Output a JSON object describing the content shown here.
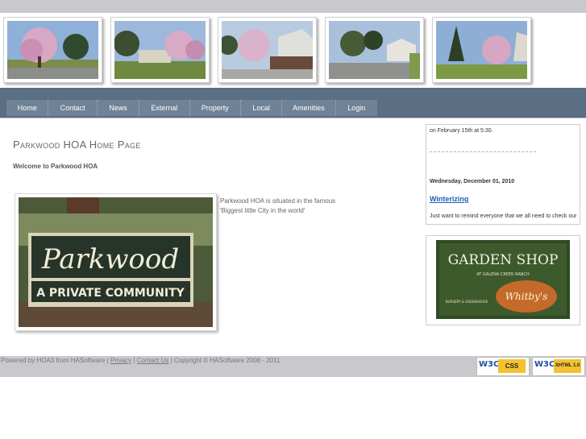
{
  "banner": {
    "photos": [
      "pink-blossom-tree-photo",
      "street-trees-photo",
      "house-blossom-photo",
      "driveway-house-photo",
      "evergreen-blossom-photo"
    ]
  },
  "nav": {
    "items": [
      {
        "label": "Home"
      },
      {
        "label": "Contact"
      },
      {
        "label": "News"
      },
      {
        "label": "External"
      },
      {
        "label": "Property"
      },
      {
        "label": "Local"
      },
      {
        "label": "Amenities"
      },
      {
        "label": "Login"
      }
    ]
  },
  "main": {
    "title": "Parkwood HOA Home Page",
    "welcome": "Welcome to Parkwood HOA",
    "sign_text_line1": "Parkwood",
    "sign_text_line2": "A PRIVATE COMMUNITY",
    "description": "Parkwood HOA is situated in the famous 'Biggest little City in the world'"
  },
  "sidebar": {
    "news_text_1": "on February 15th at 5:30.",
    "news_date": "Wednesday, December 01, 2010",
    "news_link": "Winterizing",
    "news_text_2": "Just want to remind everyone that we all need to check our",
    "ad_title": "GARDEN SHOP",
    "ad_subtitle": "AT GALENA CREEK RANCH",
    "ad_brand": "Whitby's",
    "ad_tagline": "NURSERY & GREENHOUSE"
  },
  "footer": {
    "powered": "Powered by HOA3 from HASoftware |",
    "privacy": "Privacy",
    "sep": "|",
    "contact": "Contact Us",
    "copyright": "| Copyright © HASoftware 2008 - 2011",
    "badge_css": "CSS",
    "badge_xhtml": "XHTML 1.0",
    "w3c": "W3C"
  },
  "colors": {
    "nav_bg": "#5a6e84",
    "nav_strip": "#6f8296",
    "link": "#1a5fb4",
    "footer_bg": "#c7c9cc"
  }
}
